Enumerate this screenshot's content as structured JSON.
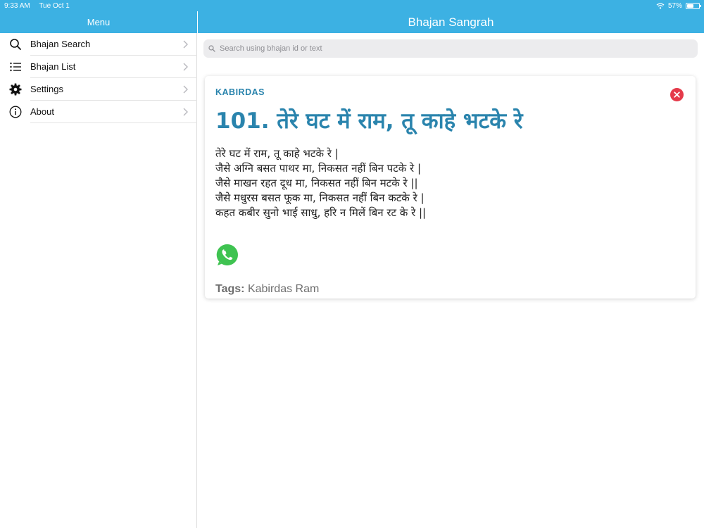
{
  "status_bar": {
    "time": "9:33 AM",
    "date": "Tue Oct 1",
    "battery": "57%",
    "battery_level": 0.57
  },
  "sidebar": {
    "title": "Menu",
    "items": [
      {
        "label": "Bhajan Search",
        "icon": "search-icon"
      },
      {
        "label": "Bhajan List",
        "icon": "list-icon"
      },
      {
        "label": "Settings",
        "icon": "gear-icon"
      },
      {
        "label": "About",
        "icon": "info-icon"
      }
    ]
  },
  "header": {
    "title": "Bhajan Sangrah"
  },
  "search": {
    "placeholder": "Search using bhajan id or text",
    "value": ""
  },
  "card": {
    "author": "KABIRDAS",
    "title": "101. तेरे घट में राम, तू काहे भटके रे",
    "lyrics": [
      "तेरे घट में राम, तू काहे भटके रे |",
      "जैसे अग्नि बसत पाथर मा, निकसत नहीं बिन पटके रे |",
      "जैसे माखन रहत दूध मा, निकसत नहीं बिन मटके रे ||",
      "जैसे मधुरस बसत फूक मा, निकसत नहीं बिन कटके रे |",
      "कहत कबीर सुनो भाई साधु, हरि न मिलें बिन रट के रे ||"
    ],
    "tags_label": "Tags:",
    "tags": "Kabirdas Ram"
  },
  "colors": {
    "accent": "#3cb1e3",
    "title_blue": "#2a84ad",
    "close_red": "#e53a4a",
    "whatsapp_green": "#3fc351"
  }
}
